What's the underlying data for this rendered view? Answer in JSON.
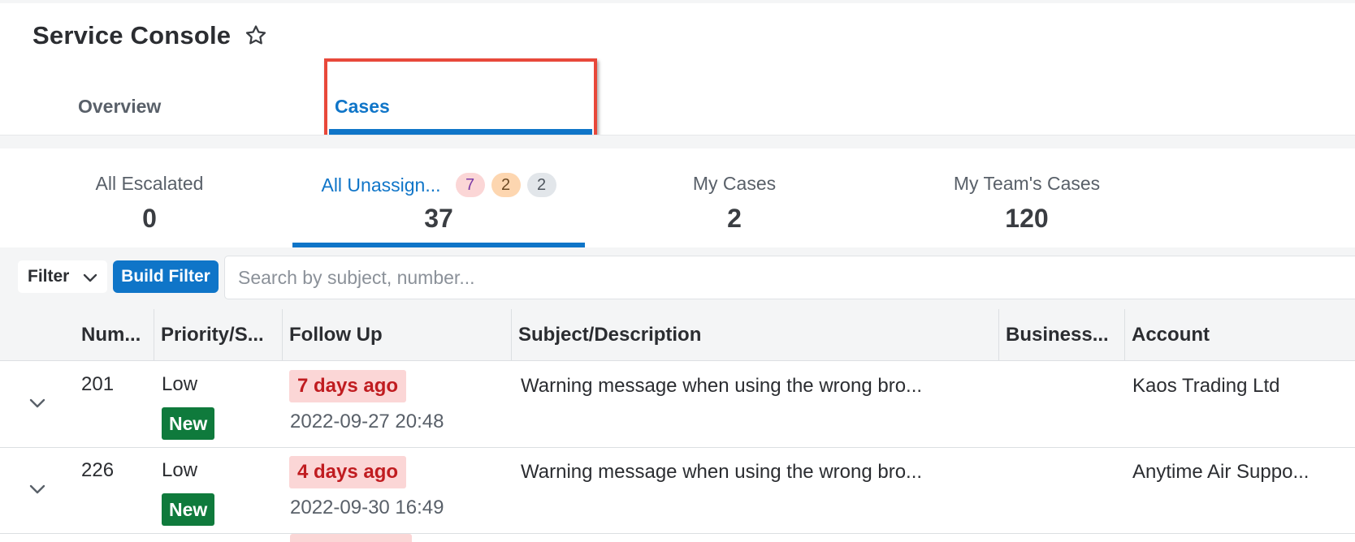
{
  "page": {
    "title": "Service Console",
    "favorite_icon": "star-outline-icon"
  },
  "main_tabs": [
    {
      "label": "Overview",
      "active": false
    },
    {
      "label": "Cases",
      "active": true
    }
  ],
  "subtabs": [
    {
      "label": "All Escalated",
      "count": "0",
      "active": false
    },
    {
      "label": "All Unassign...",
      "count": "37",
      "active": true,
      "badges": [
        "7",
        "2",
        "2"
      ]
    },
    {
      "label": "My Cases",
      "count": "2",
      "active": false
    },
    {
      "label": "My Team's Cases",
      "count": "120",
      "active": false
    }
  ],
  "filter": {
    "dropdown_label": "Filter",
    "build_filter_label": "Build Filter",
    "search_placeholder": "Search by subject, number..."
  },
  "table": {
    "columns": [
      "Num...",
      "Priority/S...",
      "Follow Up",
      "Subject/Description",
      "Business...",
      "Account"
    ],
    "rows": [
      {
        "number": "201",
        "priority": "Low",
        "status": "New",
        "followup_relative": "7 days ago",
        "followup_date": "2022-09-27 20:48",
        "subject": "Warning message when using the wrong bro...",
        "business": "",
        "account": "Kaos Trading Ltd"
      },
      {
        "number": "226",
        "priority": "Low",
        "status": "New",
        "followup_relative": "4 days ago",
        "followup_date": "2022-09-30 16:49",
        "subject": "Warning message when using the wrong bro...",
        "business": "",
        "account": "Anytime Air Suppo..."
      }
    ]
  },
  "colors": {
    "accent": "#0f75c8",
    "highlight_box": "#e8483a",
    "status_new": "#0f7a3c",
    "followup_bg": "#fbd6d6",
    "followup_text": "#c01c20"
  }
}
